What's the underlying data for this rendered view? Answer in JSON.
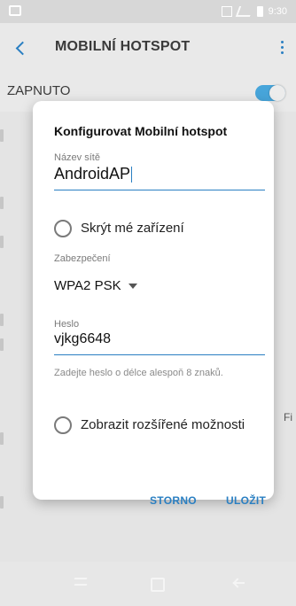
{
  "status_bar": {
    "time": "9:30"
  },
  "app_bar": {
    "title": "MOBILNÍ HOTSPOT"
  },
  "switch_row": {
    "label": "ZAPNUTO",
    "on": true
  },
  "dialog": {
    "title": "Konfigurovat Mobilní hotspot",
    "network_name": {
      "label": "Název sítě",
      "value": "AndroidAP"
    },
    "hide_device": {
      "label": "Skrýt mé zařízení",
      "checked": false
    },
    "security": {
      "label": "Zabezpečení",
      "value": "WPA2 PSK"
    },
    "password": {
      "label": "Heslo",
      "value": "vjkg6648",
      "hint": "Zadejte heslo o délce alespoň 8 znaků."
    },
    "advanced": {
      "label": "Zobrazit rozšířené možnosti",
      "checked": false
    },
    "buttons": {
      "cancel": "STORNO",
      "save": "ULOŽIT"
    }
  },
  "background_edge_text": "Fi",
  "colors": {
    "accent": "#2a7fc2",
    "toggle": "#47a5da"
  }
}
